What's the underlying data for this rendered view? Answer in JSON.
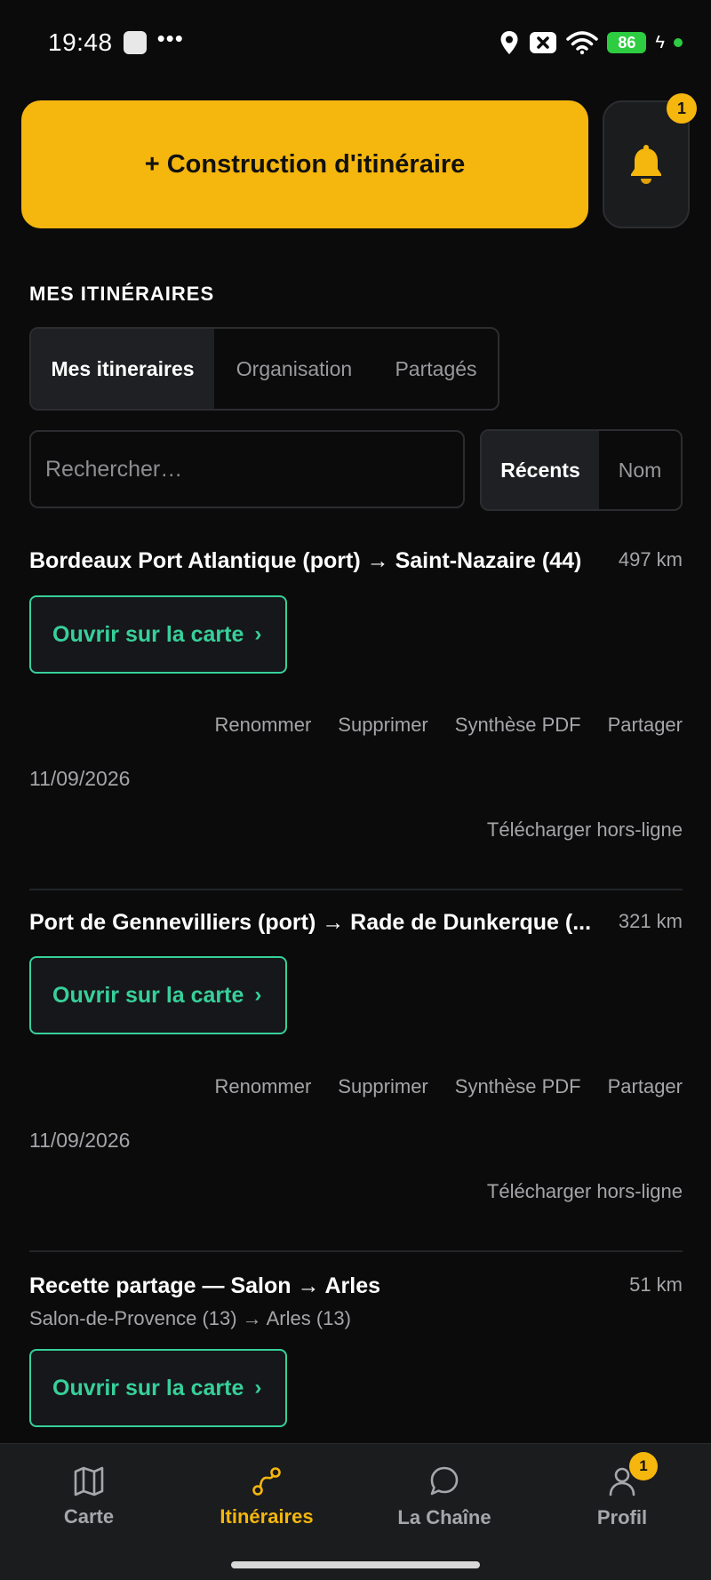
{
  "status_bar": {
    "time": "19:48",
    "dots": "•••",
    "battery": "86",
    "accent": "#2ecc40"
  },
  "header": {
    "cta_label": "+ Construction d'itinéraire",
    "notification_count": "1",
    "accent": "#f5b60d"
  },
  "section": {
    "title": "MES ITINÉRAIRES"
  },
  "tabs": [
    {
      "label": "Mes itineraires",
      "active": true
    },
    {
      "label": "Organisation",
      "active": false
    },
    {
      "label": "Partagés",
      "active": false
    }
  ],
  "search": {
    "placeholder": "Rechercher…",
    "value": ""
  },
  "sort": {
    "options": [
      "Récents",
      "Nom"
    ],
    "selected": "Récents"
  },
  "routes": [
    {
      "title": "Bordeaux Port Atlantique (port) → Saint-Nazaire (44)",
      "distance": "497 km",
      "open_label": "Ouvrir sur la carte",
      "actions": [
        "Renommer",
        "Supprimer",
        "Synthèse PDF",
        "Partager"
      ],
      "date": "11/09/2026",
      "offline": "Télécharger hors-ligne"
    },
    {
      "title": "Port de Gennevilliers (port) → Rade de Dunkerque (...",
      "distance": "321 km",
      "open_label": "Ouvrir sur la carte",
      "actions": [
        "Renommer",
        "Supprimer",
        "Synthèse PDF",
        "Partager"
      ],
      "date": "11/09/2026",
      "offline": "Télécharger hors-ligne"
    },
    {
      "title": "Recette partage — Salon → Arles",
      "subtitle": "Salon-de-Provence (13) → Arles (13)",
      "distance": "51 km",
      "open_label": "Ouvrir sur la carte"
    }
  ],
  "chevron": "›",
  "bottom_nav": {
    "items": [
      {
        "label": "Carte",
        "icon": "map-icon"
      },
      {
        "label": "Itinéraires",
        "icon": "route-icon",
        "active": true
      },
      {
        "label": "La Chaîne",
        "icon": "chat-bubble-icon"
      },
      {
        "label": "Profil",
        "icon": "user-icon",
        "badge": "1"
      }
    ],
    "active_color": "#f5b60d"
  }
}
